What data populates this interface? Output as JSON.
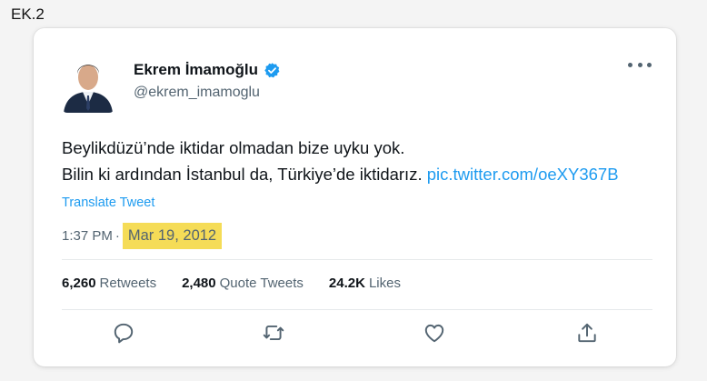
{
  "page_label": "EK.2",
  "tweet": {
    "author_name": "Ekrem İmamoğlu",
    "handle": "@ekrem_imamoglu",
    "verified": true,
    "text_line1": "Beylikdüzü’nde iktidar olmadan bize uyku yok.",
    "text_line2": "Bilin ki ardından İstanbul da, Türkiye’de iktidarız.",
    "link": "pic.twitter.com/oeXY367B",
    "translate_label": "Translate Tweet",
    "time": "1:37 PM",
    "separator": "·",
    "date": "Mar 19, 2012",
    "highlight_color": "#f5dc57",
    "stats": {
      "retweets_count": "6,260",
      "retweets_label": "Retweets",
      "quotes_count": "2,480",
      "quotes_label": "Quote Tweets",
      "likes_count": "24.2K",
      "likes_label": "Likes"
    },
    "actions": [
      "reply-icon",
      "retweet-icon",
      "like-icon",
      "share-icon"
    ],
    "accent_color": "#1d9bf0"
  }
}
